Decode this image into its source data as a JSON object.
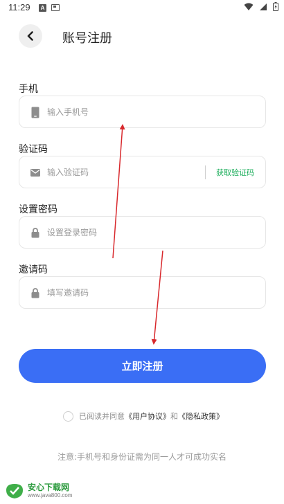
{
  "status_bar": {
    "time": "11:29",
    "a_icon_label": "A"
  },
  "header": {
    "title": "账号注册"
  },
  "form": {
    "phone": {
      "label": "手机",
      "placeholder": "输入手机号"
    },
    "code": {
      "label": "验证码",
      "placeholder": "输入验证码",
      "get_code_label": "获取验证码"
    },
    "password": {
      "label": "设置密码",
      "placeholder": "设置登录密码"
    },
    "invite": {
      "label": "邀请码",
      "placeholder": "填写邀请码"
    }
  },
  "register_button": {
    "label": "立即注册"
  },
  "agreement": {
    "prefix": "已阅读并同意",
    "user_agreement": "《用户协议》",
    "and": "和",
    "privacy_policy": "《隐私政策》"
  },
  "notice": "注意:手机号和身份证需为同一人才可成功实名",
  "watermark": {
    "title": "安心下载网",
    "url": "www.java800.com"
  },
  "colors": {
    "primary": "#3a6ef5",
    "code_link": "#1aad5a",
    "arrow": "#d8282c"
  },
  "icons": {
    "back": "chevron-left-icon",
    "phone": "phone-icon",
    "code": "mail-icon",
    "password": "lock-icon",
    "invite": "lock-icon"
  }
}
